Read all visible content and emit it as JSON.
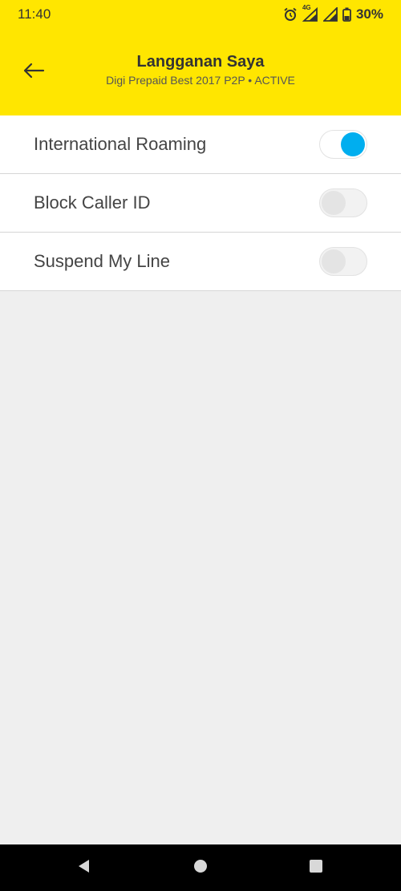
{
  "status_bar": {
    "time": "11:40",
    "battery": "30%",
    "network_label": "4G"
  },
  "header": {
    "title": "Langganan Saya",
    "subtitle": "Digi Prepaid Best 2017 P2P • ACTIVE"
  },
  "settings": [
    {
      "label": "International Roaming",
      "enabled": true
    },
    {
      "label": "Block Caller ID",
      "enabled": false
    },
    {
      "label": "Suspend My Line",
      "enabled": false
    }
  ],
  "colors": {
    "header": "#ffe600",
    "toggle_on": "#00aeef",
    "background": "#efefef"
  }
}
